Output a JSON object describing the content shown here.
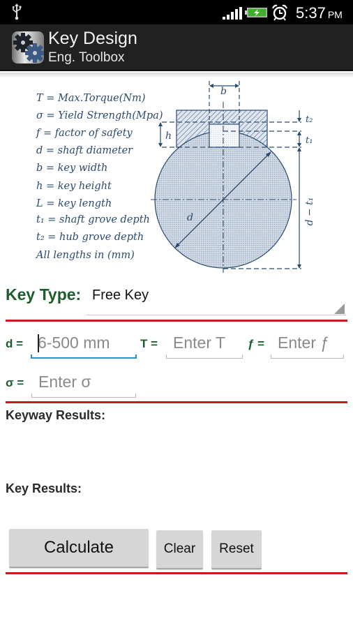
{
  "status_bar": {
    "icons": [
      "usb-icon",
      "signal-icon",
      "battery-charging-icon",
      "alarm-icon"
    ],
    "time": "5:37",
    "ampm": "PM"
  },
  "action_bar": {
    "app_icon": "gears-icon",
    "title": "Key Design",
    "subtitle": "Eng. Toolbox"
  },
  "diagram": {
    "legend": [
      "T = Max.Torque(Nm)",
      "σ = Yield Strength(Mpa)",
      "f = factor of safety",
      "d = shaft diameter",
      "b = key width",
      "h = key height",
      "L = key length",
      "t₁ = shaft grove depth",
      "t₂ = hub grove depth",
      "All lengths in (mm)"
    ],
    "labels": {
      "b": "b",
      "h": "h",
      "t1": "t₁",
      "t2": "t₂",
      "d": "d",
      "d_minus_t1": "d − t₁"
    },
    "colors": {
      "line": "#2b4a70",
      "fill": "#c7d3e0"
    }
  },
  "key_type": {
    "label": "Key Type:",
    "selected": "Free Key"
  },
  "inputs": {
    "d": {
      "label": "d =",
      "value": "",
      "placeholder": "6-500 mm"
    },
    "T": {
      "label": "T =",
      "value": "",
      "placeholder": "Enter T"
    },
    "f": {
      "label": "ƒ =",
      "value": "",
      "placeholder": "Enter ƒ"
    },
    "sigma": {
      "label": "σ =",
      "value": "",
      "placeholder": "Enter σ"
    }
  },
  "results": {
    "keyway_title": "Keyway Results:",
    "key_title": "Key Results:"
  },
  "buttons": {
    "calculate": "Calculate",
    "clear": "Clear",
    "reset": "Reset"
  },
  "colors": {
    "accent_green": "#1b5e2a",
    "divider_red": "#c8191e",
    "focus_blue": "#2c90c9"
  }
}
